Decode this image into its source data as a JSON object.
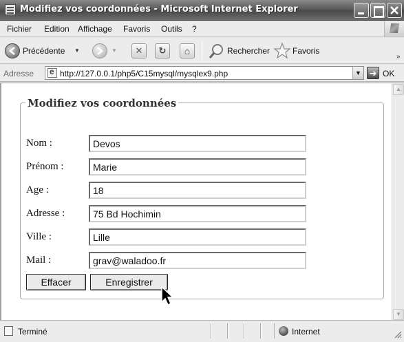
{
  "window": {
    "title": "Modifiez vos coordonnées - Microsoft Internet Explorer"
  },
  "menu": {
    "items": [
      "Fichier",
      "Edition",
      "Affichage",
      "Favoris",
      "Outils",
      "?"
    ]
  },
  "toolbar": {
    "back_label": "Précédente",
    "search_label": "Rechercher",
    "favorites_label": "Favoris",
    "more": "»"
  },
  "address": {
    "label": "Adresse",
    "url": "http://127.0.0.1/php5/C15mysql/mysqlex9.php",
    "go_label": "OK"
  },
  "form": {
    "legend": "Modifiez vos coordonnées",
    "fields": [
      {
        "label": "Nom :",
        "value": "Devos"
      },
      {
        "label": "Prénom :",
        "value": "Marie"
      },
      {
        "label": "Age :",
        "value": "18"
      },
      {
        "label": "Adresse :",
        "value": "75 Bd Hochimin"
      },
      {
        "label": "Ville :",
        "value": "Lille"
      },
      {
        "label": "Mail :",
        "value": "grav@waladoo.fr"
      }
    ],
    "reset_label": "Effacer",
    "submit_label": "Enregistrer"
  },
  "status": {
    "text": "Terminé",
    "zone": "Internet"
  }
}
